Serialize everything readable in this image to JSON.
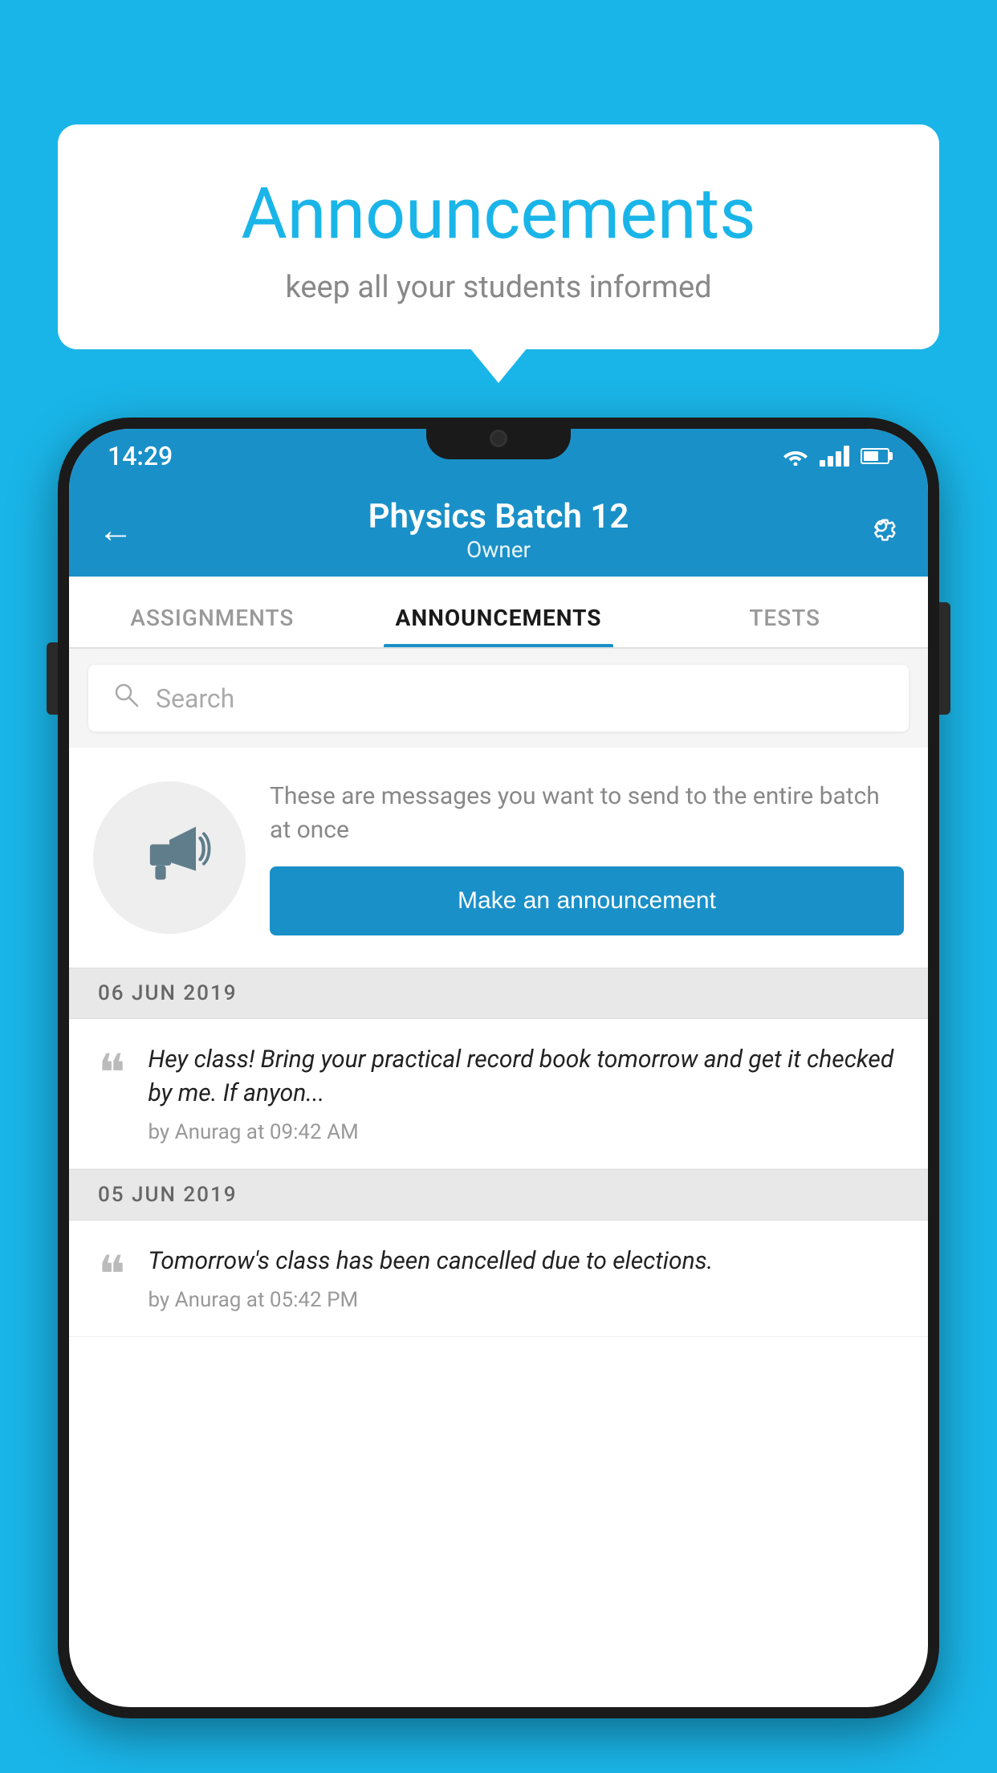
{
  "background_color": "#1ab5e8",
  "speech_bubble": {
    "title": "Announcements",
    "subtitle": "keep all your students informed"
  },
  "phone": {
    "status_bar": {
      "time": "14:29"
    },
    "header": {
      "title": "Physics Batch 12",
      "subtitle": "Owner",
      "back_label": "←",
      "settings_label": "⚙"
    },
    "tabs": [
      {
        "label": "ASSIGNMENTS",
        "active": false
      },
      {
        "label": "ANNOUNCEMENTS",
        "active": true
      },
      {
        "label": "TESTS",
        "active": false
      }
    ],
    "search": {
      "placeholder": "Search"
    },
    "promo": {
      "description": "These are messages you want to send to the entire batch at once",
      "button_label": "Make an announcement"
    },
    "announcements": [
      {
        "date": "06  JUN  2019",
        "text": "Hey class! Bring your practical record book tomorrow and get it checked by me. If anyon...",
        "meta": "by Anurag at 09:42 AM"
      },
      {
        "date": "05  JUN  2019",
        "text": "Tomorrow's class has been cancelled due to elections.",
        "meta": "by Anurag at 05:42 PM"
      }
    ]
  }
}
